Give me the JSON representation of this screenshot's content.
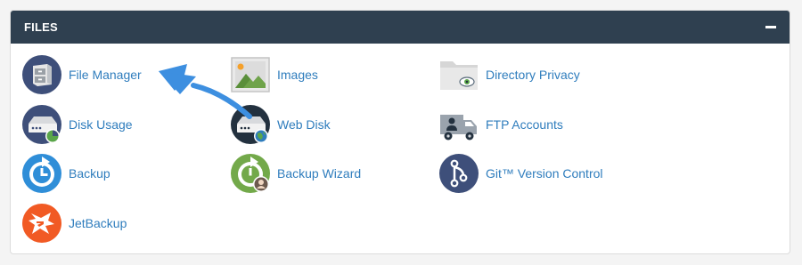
{
  "section": {
    "title": "FILES",
    "collapse_glyph": "minus-icon"
  },
  "items": [
    {
      "id": "file-manager",
      "label": "File Manager",
      "icon": "file-manager-icon"
    },
    {
      "id": "images",
      "label": "Images",
      "icon": "images-icon"
    },
    {
      "id": "directory-privacy",
      "label": "Directory Privacy",
      "icon": "directory-privacy-icon"
    },
    {
      "id": "disk-usage",
      "label": "Disk Usage",
      "icon": "disk-usage-icon"
    },
    {
      "id": "web-disk",
      "label": "Web Disk",
      "icon": "web-disk-icon"
    },
    {
      "id": "ftp-accounts",
      "label": "FTP Accounts",
      "icon": "ftp-accounts-icon"
    },
    {
      "id": "backup",
      "label": "Backup",
      "icon": "backup-icon"
    },
    {
      "id": "backup-wizard",
      "label": "Backup Wizard",
      "icon": "backup-wizard-icon"
    },
    {
      "id": "git-version-control",
      "label": "Git™ Version Control",
      "icon": "git-icon"
    },
    {
      "id": "jetbackup",
      "label": "JetBackup",
      "icon": "jetbackup-icon"
    }
  ],
  "annotation": {
    "icon": "pointer-arrow-icon",
    "color": "#3d8fe0"
  },
  "colors": {
    "header_bg": "#2f4050",
    "link": "#2f7dbd",
    "icon_navy": "#3e4f7a"
  }
}
